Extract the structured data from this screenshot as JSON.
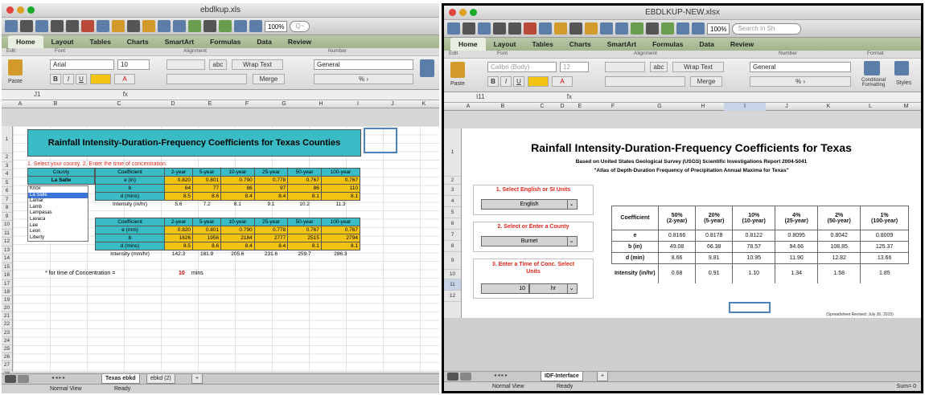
{
  "left": {
    "title": "ebdlkup.xls",
    "zoom": "100%",
    "search_label": "Q~",
    "ribbon_tabs": [
      "Home",
      "Layout",
      "Tables",
      "Charts",
      "SmartArt",
      "Formulas",
      "Data",
      "Review"
    ],
    "ribbon_groups": [
      "Edit",
      "Font",
      "Alignment",
      "Number"
    ],
    "font_name": "Arial",
    "font_size": "10",
    "wrap_text": "Wrap Text",
    "merge": "Merge",
    "number_format": "General",
    "paste": "Paste",
    "name_box": "J1",
    "fx": "fx",
    "columns": [
      "A",
      "B",
      "C",
      "D",
      "E",
      "F",
      "G",
      "H",
      "I",
      "J",
      "K"
    ],
    "rows": [
      "1",
      "2",
      "3",
      "4",
      "5",
      "6",
      "7",
      "8",
      "9",
      "10",
      "11",
      "12",
      "13",
      "14",
      "15",
      "16",
      "17",
      "18",
      "19",
      "20",
      "21",
      "22",
      "23",
      "24",
      "25",
      "26",
      "27",
      "28",
      "29"
    ],
    "sheet_title": "Rainfall Intensity-Duration-Frequency Coefficients for Texas Counties",
    "instructions": "1. Select your county.  2. Enter the time of concentration.",
    "county_header": "County",
    "county_value": "La Salle",
    "county_list": [
      "Knox",
      "La Salle",
      "Lamar",
      "Lamb",
      "Lampasas",
      "Lavaca",
      "Lee",
      "Leon",
      "Liberty"
    ],
    "coef_header": "Coefficient",
    "periods": [
      "2-year",
      "5-year",
      "10-year",
      "25-year",
      "50-year",
      "100-year"
    ],
    "t1_rows": [
      {
        "label": "e (in)",
        "values": [
          "0.820",
          "0.801",
          "0.790",
          "0.778",
          "0.767",
          "0.767"
        ]
      },
      {
        "label": "b",
        "values": [
          "64",
          "77",
          "86",
          "97",
          "86",
          "110"
        ]
      },
      {
        "label": "d (mins)",
        "values": [
          "8.5",
          "8.6",
          "8.4",
          "8.4",
          "8.1",
          "8.1"
        ]
      }
    ],
    "t1_intensity": {
      "label": "Intensity (in/hr)",
      "values": [
        "5.6",
        "7.2",
        "8.1",
        "9.1",
        "10.2",
        "11.3"
      ]
    },
    "t2_rows": [
      {
        "label": "e (mm)",
        "values": [
          "0.820",
          "0.801",
          "0.790",
          "0.778",
          "0.767",
          "0.767"
        ]
      },
      {
        "label": "b",
        "values": [
          "1626",
          "1956",
          "2184",
          "2777",
          "2515",
          "2794"
        ]
      },
      {
        "label": "d (mins)",
        "values": [
          "8.5",
          "8.6",
          "8.4",
          "8.4",
          "8.1",
          "8.1"
        ]
      }
    ],
    "t2_intensity": {
      "label": "Intensity (mm/hr)",
      "values": [
        "142.3",
        "181.9",
        "205.6",
        "231.6",
        "259.7",
        "286.3"
      ]
    },
    "tc_label": "* for time of Concentration =",
    "tc_value": "10",
    "tc_unit": "mins",
    "sheet_tabs": [
      "Texas ebkd",
      "ebkd (2)"
    ],
    "status_view": "Normal View",
    "status_ready": "Ready"
  },
  "right": {
    "title": "EBDLKUP-NEW.xlsx",
    "zoom": "100%",
    "search_label": "Search in Sh",
    "ribbon_tabs": [
      "Home",
      "Layout",
      "Tables",
      "Charts",
      "SmartArt",
      "Formulas",
      "Data",
      "Review"
    ],
    "ribbon_groups": [
      "Edit",
      "Font",
      "Alignment",
      "Number",
      "Format"
    ],
    "font_name": "Calibri (Body)",
    "font_size": "12",
    "wrap_text": "Wrap Text",
    "merge": "Merge",
    "number_format": "General",
    "paste": "Paste",
    "cond_format": "Conditional Formatting",
    "styles": "Styles",
    "name_box": "I11",
    "fx": "fx",
    "columns": [
      "A",
      "B",
      "C",
      "D",
      "E",
      "F",
      "G",
      "H",
      "I",
      "J",
      "K",
      "L",
      "M"
    ],
    "rows": [
      "1",
      "2",
      "3",
      "4",
      "5",
      "6",
      "7",
      "8",
      "9",
      "10",
      "11",
      "12"
    ],
    "sheet_title": "Rainfall Intensity-Duration-Frequency Coefficients for Texas",
    "subtitle1": "Based on United States Geological Survey (USGS) Scientific Investigations Report 2004-5041",
    "subtitle2": "\"Atlas of Depth-Duration Frequency of Precipitation Annual Maxima for Texas\"",
    "step1": "1. Select English or SI Units",
    "step1_value": "English",
    "step2": "2. Select or Enter a County",
    "step2_value": "Burnet",
    "step3": "3. Enter a Time of Conc. Select Units",
    "step3_value": "10",
    "step3_unit": "hr",
    "coef_header": "Coefficient",
    "periods": [
      {
        "pct": "50%",
        "yr": "(2-year)"
      },
      {
        "pct": "20%",
        "yr": "(5-year)"
      },
      {
        "pct": "10%",
        "yr": "(10-year)"
      },
      {
        "pct": "4%",
        "yr": "(25-year)"
      },
      {
        "pct": "2%",
        "yr": "(50-year)"
      },
      {
        "pct": "1%",
        "yr": "(100-year)"
      }
    ],
    "rows_data": [
      {
        "label": "e",
        "values": [
          "0.8166",
          "0.8178",
          "0.8122",
          "0.8095",
          "0.8042",
          "0.8009"
        ]
      },
      {
        "label": "b (in)",
        "values": [
          "49.08",
          "66.38",
          "78.57",
          "94.66",
          "108.85",
          "125.37"
        ]
      },
      {
        "label": "d (min)",
        "values": [
          "8.66",
          "9.81",
          "10.95",
          "11.90",
          "12.82",
          "13.66"
        ]
      }
    ],
    "intensity": {
      "label": "Intensity (in/hr)",
      "values": [
        "0.68",
        "0.91",
        "1.10",
        "1.34",
        "1.58",
        "1.85"
      ]
    },
    "revised": "(Spreadsheet Revised: July 30, 2015)",
    "sheet_tabs": [
      "IDF-Interface"
    ],
    "status_view": "Normal View",
    "status_ready": "Ready",
    "status_sum": "Sum= 0"
  }
}
